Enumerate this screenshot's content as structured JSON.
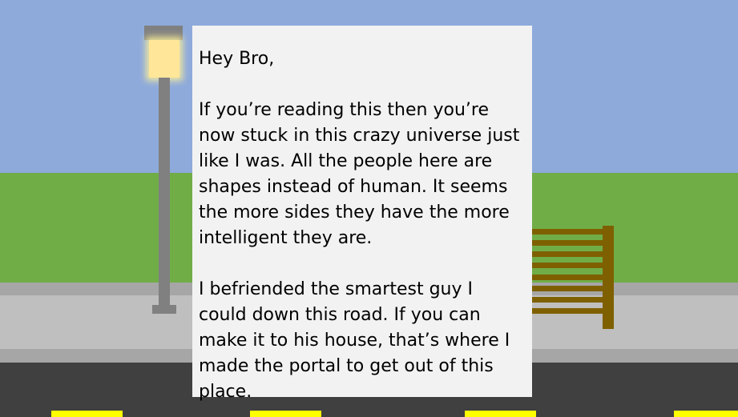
{
  "scene": {
    "colors": {
      "sky": "#8eaadb",
      "grass": "#70ad47",
      "curb": "#a6a6a6",
      "sidewalk": "#bfbfbf",
      "road": "#404040",
      "lane_marking": "#ffff00",
      "lamp_post": "#808080",
      "lamp_light": "#ffe699",
      "bench": "#7f6000",
      "letter_paper": "#f2f2f2"
    }
  },
  "letter": {
    "greeting": "Hey Bro,",
    "paragraph_1": "If you’re reading this then you’re now stuck in this crazy universe just like I was. All the people here are shapes instead of human. It seems the more sides they have the more intelligent they are.",
    "paragraph_2": "I befriended the smartest guy I could down this road. If you can make it to his house, that’s where I made the portal to get out of this place."
  }
}
